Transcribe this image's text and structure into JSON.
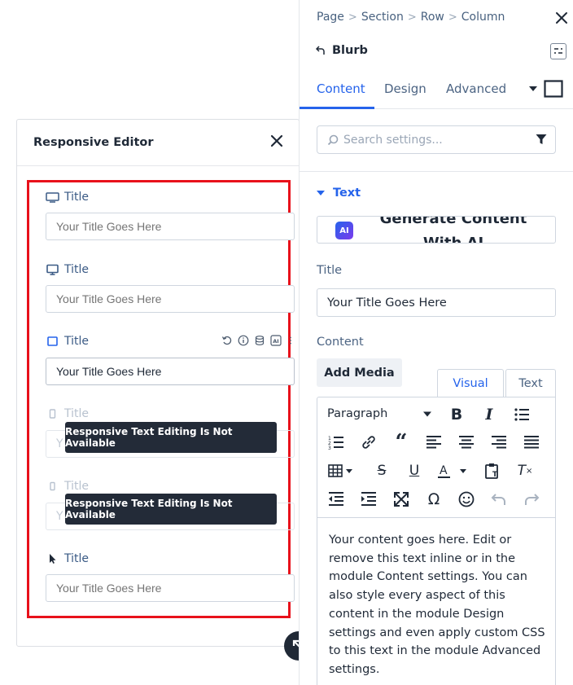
{
  "responsive_editor": {
    "title": "Responsive Editor",
    "rows": [
      {
        "device": "desktop-wide",
        "label": "Title",
        "placeholder": "Your Title Goes Here",
        "value": "",
        "state": "enabled"
      },
      {
        "device": "desktop",
        "label": "Title",
        "placeholder": "Your Title Goes Here",
        "value": "",
        "state": "enabled"
      },
      {
        "device": "tablet",
        "label": "Title",
        "placeholder": "",
        "value": "Your Title Goes Here",
        "state": "active"
      },
      {
        "device": "phone",
        "label": "Title",
        "tooltip": "Responsive Text Editing Is Not Available",
        "state": "disabled"
      },
      {
        "device": "phone-small",
        "label": "Title",
        "tooltip": "Responsive Text Editing Is Not Available",
        "state": "disabled"
      },
      {
        "device": "hover",
        "label": "Title",
        "placeholder": "Your Title Goes Here",
        "value": "",
        "state": "enabled"
      }
    ],
    "tool_icons": [
      "reset-icon",
      "info-icon",
      "database-icon",
      "ai-icon",
      "more-vertical-icon"
    ],
    "highlight_color": "#e8111b"
  },
  "sidebar": {
    "breadcrumbs": [
      "Page",
      "Section",
      "Row",
      "Column"
    ],
    "module_name": "Blurb",
    "tabs": [
      "Content",
      "Design",
      "Advanced"
    ],
    "active_tab": "Content",
    "search_placeholder": "Search settings...",
    "group_title": "Text",
    "ai_button_text": "Generate Content With AI",
    "ai_badge": "AI",
    "title_label": "Title",
    "title_value": "Your Title Goes Here",
    "content_label": "Content",
    "add_media": "Add Media",
    "editor_tabs": [
      "Visual",
      "Text"
    ],
    "active_editor_tab": "Visual",
    "paragraph_select": "Paragraph",
    "content_text": "Your content goes here. Edit or remove this text inline or in the module Content settings. You can also style every aspect of this content in the module Design settings and even apply custom CSS to this text in the module Advanced settings."
  },
  "colors": {
    "accent": "#2563eb",
    "highlight": "#e8111b",
    "tooltip_bg": "#232b38",
    "label": "#4c6483"
  }
}
